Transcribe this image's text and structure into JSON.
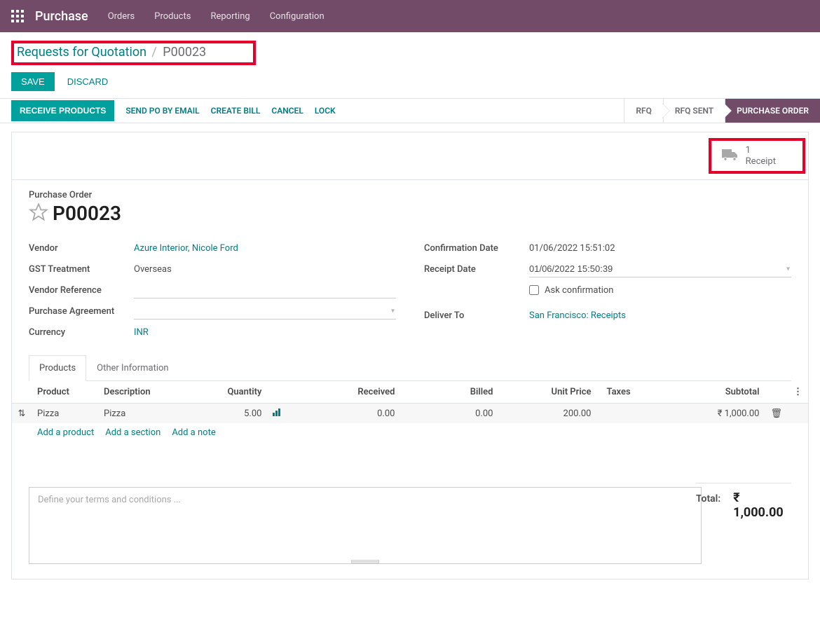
{
  "topbar": {
    "app_title": "Purchase",
    "menu": [
      "Orders",
      "Products",
      "Reporting",
      "Configuration"
    ]
  },
  "breadcrumb": {
    "parent": "Requests for Quotation",
    "current": "P00023"
  },
  "actions": {
    "save": "SAVE",
    "discard": "DISCARD"
  },
  "statusbar": {
    "receive": "RECEIVE PRODUCTS",
    "send_email": "SEND PO BY EMAIL",
    "create_bill": "CREATE BILL",
    "cancel": "CANCEL",
    "lock": "LOCK",
    "stages": [
      "RFQ",
      "RFQ SENT",
      "PURCHASE ORDER"
    ]
  },
  "stat_button": {
    "count": "1",
    "label": "Receipt"
  },
  "title": {
    "small": "Purchase Order",
    "main": "P00023"
  },
  "fields_left": {
    "vendor_label": "Vendor",
    "vendor_value": "Azure Interior, Nicole Ford",
    "gst_label": "GST Treatment",
    "gst_value": "Overseas",
    "vendor_ref_label": "Vendor Reference",
    "vendor_ref_value": "",
    "pa_label": "Purchase Agreement",
    "pa_value": "",
    "currency_label": "Currency",
    "currency_value": "INR"
  },
  "fields_right": {
    "confirm_label": "Confirmation Date",
    "confirm_value": "01/06/2022 15:51:02",
    "receipt_label": "Receipt Date",
    "receipt_value": "01/06/2022 15:50:39",
    "ask_label": "Ask confirmation",
    "deliver_label": "Deliver To",
    "deliver_value": "San Francisco: Receipts"
  },
  "tabs": {
    "products": "Products",
    "other": "Other Information"
  },
  "table": {
    "headers": {
      "product": "Product",
      "description": "Description",
      "quantity": "Quantity",
      "received": "Received",
      "billed": "Billed",
      "unit_price": "Unit Price",
      "taxes": "Taxes",
      "subtotal": "Subtotal"
    },
    "rows": [
      {
        "product": "Pizza",
        "description": "Pizza",
        "quantity": "5.00",
        "received": "0.00",
        "billed": "0.00",
        "unit_price": "200.00",
        "taxes": "",
        "subtotal": "₹ 1,000.00"
      }
    ],
    "add_product": "Add a product",
    "add_section": "Add a section",
    "add_note": "Add a note"
  },
  "terms_placeholder": "Define your terms and conditions ...",
  "total": {
    "label": "Total:",
    "value": "₹ 1,000.00"
  }
}
